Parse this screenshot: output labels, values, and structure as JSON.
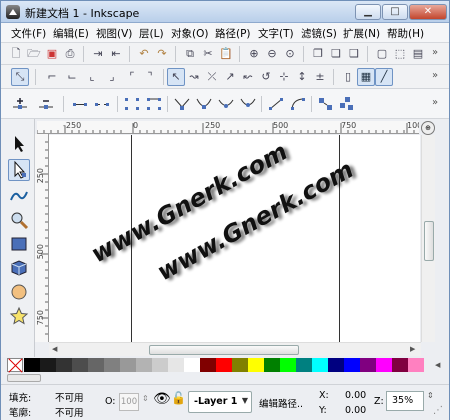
{
  "window": {
    "title": "新建文档 1 - Inkscape",
    "controls": {
      "minimize": "▁",
      "maximize": "□",
      "close": "✕"
    }
  },
  "menu": [
    "文件(F)",
    "编辑(E)",
    "视图(V)",
    "层(L)",
    "对象(O)",
    "路径(P)",
    "文字(T)",
    "滤镜(S)",
    "扩展(N)",
    "帮助(H)"
  ],
  "toolbar_more": "»",
  "ruler": {
    "h_labels": [
      "-250",
      "0",
      "250",
      "500",
      "750",
      "1000"
    ],
    "v_labels": [
      "250",
      "500",
      "750"
    ]
  },
  "canvas": {
    "watermarks": [
      "www.Gnerk.com",
      "www.Gnerk.com"
    ]
  },
  "palette": {
    "swatches": [
      "#000000",
      "#1a1a1a",
      "#333333",
      "#4d4d4d",
      "#666666",
      "#808080",
      "#999999",
      "#b3b3b3",
      "#cccccc",
      "#e6e6e6",
      "#ffffff",
      "#800000",
      "#ff0000",
      "#808000",
      "#ffff00",
      "#008000",
      "#00ff00",
      "#008080",
      "#00ffff",
      "#000080",
      "#0000ff",
      "#800080",
      "#ff00ff",
      "#800040",
      "#ff80c0"
    ]
  },
  "status": {
    "fill_label": "填充:",
    "fill_value": "不可用",
    "stroke_label": "笔廓:",
    "stroke_value": "不可用",
    "opacity_label": "O:",
    "opacity_value": "100",
    "layer": "-Layer 1",
    "message": "编辑路径..",
    "x_label": "X:",
    "x_value": "0.00",
    "y_label": "Y:",
    "y_value": "0.00",
    "zoom_label": "Z:",
    "zoom_value": "35%"
  }
}
